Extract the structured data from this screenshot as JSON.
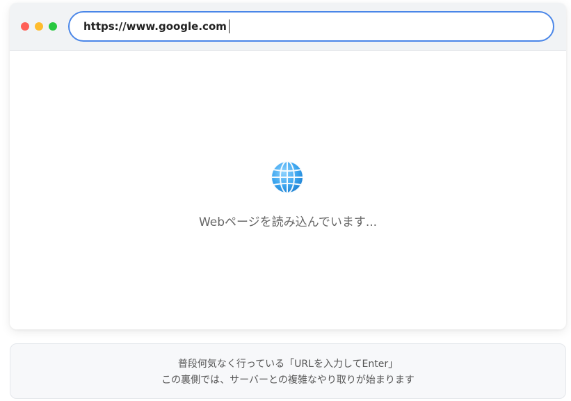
{
  "browser": {
    "url": "https://www.google.com",
    "traffic_lights": {
      "close_color": "#ff5f57",
      "minimize_color": "#febc2e",
      "maximize_color": "#28c840"
    },
    "url_bar_border_color": "#4a86e8"
  },
  "content": {
    "icon": "globe-icon",
    "loading_message": "Webページを読み込んでいます..."
  },
  "caption": {
    "line1": "普段何気なく行っている「URLを入力してEnter」",
    "line2": "この裏側では、サーバーとの複雑なやり取りが始まります"
  }
}
